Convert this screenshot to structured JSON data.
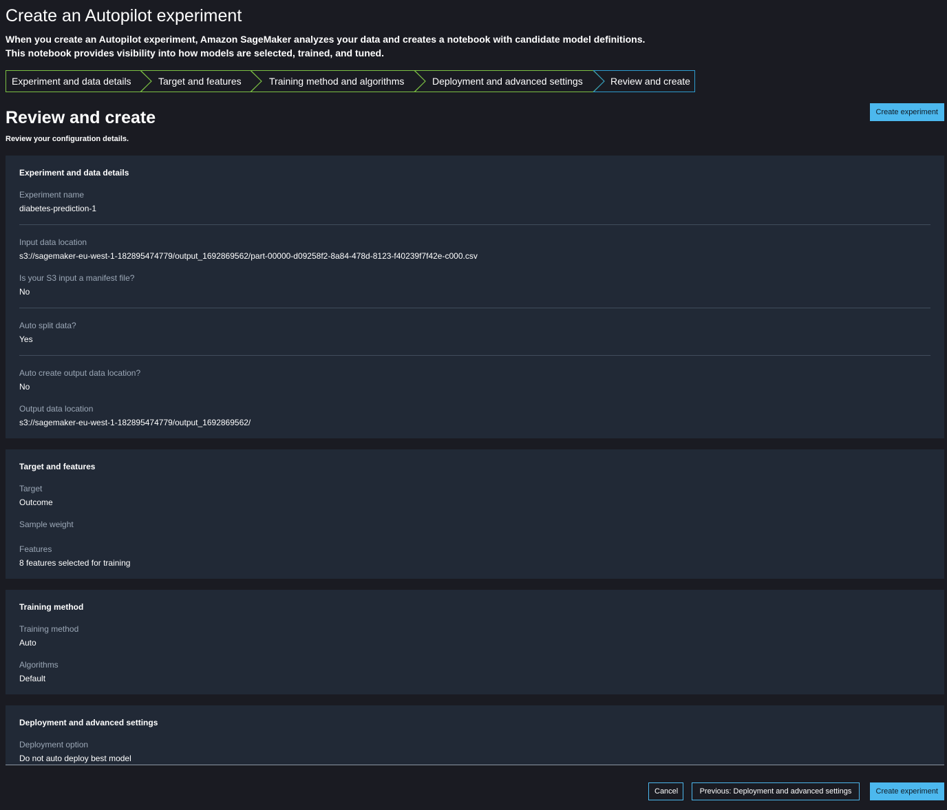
{
  "page": {
    "title": "Create an Autopilot experiment",
    "description_line1": "When you create an Autopilot experiment, Amazon SageMaker analyzes your data and creates a notebook with candidate model definitions.",
    "description_line2": "This notebook provides visibility into how models are selected, trained, and tuned."
  },
  "steps": [
    {
      "label": "Experiment and data details",
      "state": "complete"
    },
    {
      "label": "Target and features",
      "state": "complete"
    },
    {
      "label": "Training method and algorithms",
      "state": "complete"
    },
    {
      "label": "Deployment and advanced settings",
      "state": "complete"
    },
    {
      "label": "Review and create",
      "state": "current"
    }
  ],
  "colors": {
    "background": "#1a1b22",
    "card": "#212936",
    "step_complete": "#7cc144",
    "step_current": "#2e9ccf",
    "primary_button": "#4cb8ee"
  },
  "review": {
    "title": "Review and create",
    "subtitle": "Review your configuration details.",
    "create_button": "Create experiment"
  },
  "experiment_card": {
    "heading": "Experiment and data details",
    "experiment_name_label": "Experiment name",
    "experiment_name_value": "diabetes-prediction-1",
    "input_location_label": "Input data location",
    "input_location_value": "s3://sagemaker-eu-west-1-182895474779/output_1692869562/part-00000-d09258f2-8a84-478d-8123-f40239f7f42e-c000.csv",
    "manifest_label": "Is your S3 input a manifest file?",
    "manifest_value": "No",
    "auto_split_label": "Auto split data?",
    "auto_split_value": "Yes",
    "auto_output_label": "Auto create output data location?",
    "auto_output_value": "No",
    "output_location_label": "Output data location",
    "output_location_value": "s3://sagemaker-eu-west-1-182895474779/output_1692869562/"
  },
  "target_card": {
    "heading": "Target and features",
    "target_label": "Target",
    "target_value": "Outcome",
    "sample_weight_label": "Sample weight",
    "features_label": "Features",
    "features_value": "8 features selected for training"
  },
  "training_card": {
    "heading": "Training method",
    "method_label": "Training method",
    "method_value": "Auto",
    "algorithms_label": "Algorithms",
    "algorithms_value": "Default"
  },
  "deployment_card": {
    "heading": "Deployment and advanced settings",
    "option_label": "Deployment option",
    "option_value": "Do not auto deploy best model"
  },
  "footer": {
    "cancel": "Cancel",
    "previous": "Previous: Deployment and advanced settings",
    "create": "Create experiment"
  }
}
